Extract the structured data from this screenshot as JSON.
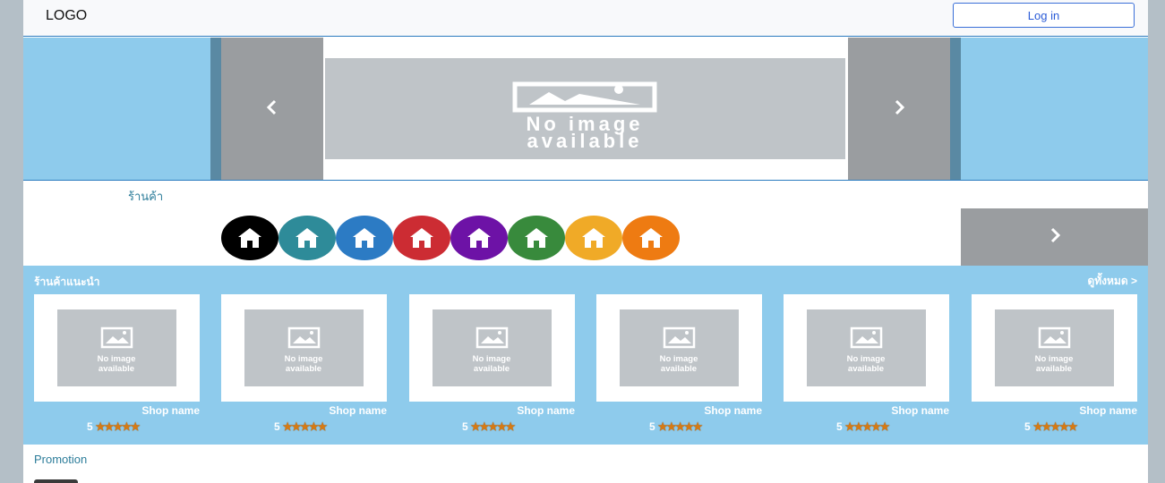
{
  "header": {
    "logo_text": "LOGO",
    "login_label": "Log in"
  },
  "banner": {
    "placeholder_text": "No image available"
  },
  "shops": {
    "title": "ร้านค้า",
    "icon_colors": [
      "#000000",
      "#2e8b99",
      "#2c7bc4",
      "#cc2c33",
      "#6d12a6",
      "#388a3c",
      "#f0aa27",
      "#ee7b12"
    ]
  },
  "recommended": {
    "title": "ร้านค้าแนะนำ",
    "see_all": "ดูทั้งหมด >",
    "shops": [
      {
        "name": "Shop name",
        "rating": "5",
        "image_text": "No image available"
      },
      {
        "name": "Shop name",
        "rating": "5",
        "image_text": "No image available"
      },
      {
        "name": "Shop name",
        "rating": "5",
        "image_text": "No image available"
      },
      {
        "name": "Shop name",
        "rating": "5",
        "image_text": "No image available"
      },
      {
        "name": "Shop name",
        "rating": "5",
        "image_text": "No image available"
      },
      {
        "name": "Shop name",
        "rating": "5",
        "image_text": "No image available"
      }
    ]
  },
  "promotion": {
    "title": "Promotion"
  }
}
